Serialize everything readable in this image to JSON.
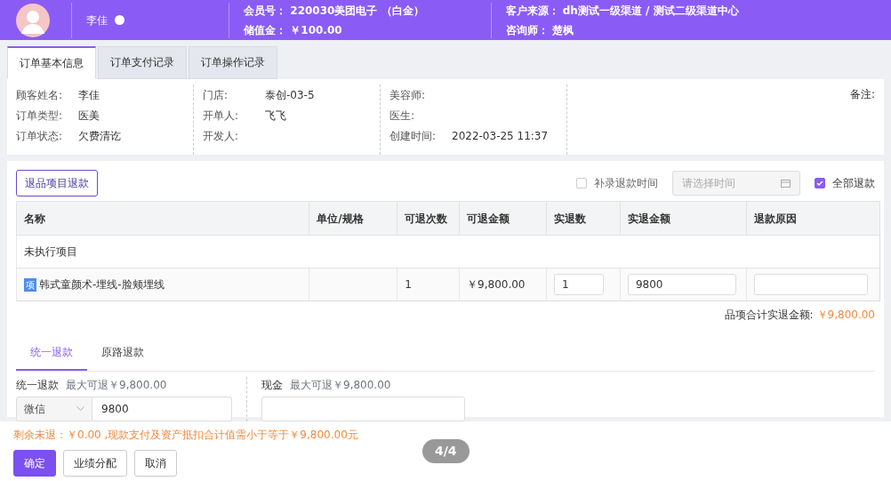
{
  "header": {
    "name": "李佳",
    "fields": [
      {
        "label": "会员号：",
        "value": "220030美团电子 （白金）"
      },
      {
        "label": "储值金：",
        "value": "￥100.00"
      },
      {
        "label": "客户来源：",
        "value": "dh测试一级渠道 / 测试二级渠道中心"
      },
      {
        "label": "咨询师：",
        "value": "楚枫"
      }
    ]
  },
  "tabs": [
    {
      "label": "订单基本信息",
      "selected": true
    },
    {
      "label": "订单支付记录",
      "selected": false
    },
    {
      "label": "订单操作记录",
      "selected": false
    }
  ],
  "info": {
    "columns": [
      [
        {
          "label": "顾客姓名:",
          "value": "李佳"
        },
        {
          "label": "订单类型:",
          "value": "医美"
        },
        {
          "label": "订单状态:",
          "value": "欠费清讫"
        }
      ],
      [
        {
          "label": "门店:",
          "value": "泰创-03-5"
        },
        {
          "label": "开单人:",
          "value": "飞飞"
        },
        {
          "label": "开发人:"
        }
      ],
      [
        {
          "label": "美容师:"
        },
        {
          "label": "医生:"
        },
        {
          "label": "创建时间:",
          "value": "2022-03-25 11:37"
        }
      ]
    ],
    "remark_label": "备注:"
  },
  "refund": {
    "return_button": "退品项目退款",
    "supplement": {
      "label": "补录退款时间",
      "checked": false
    },
    "date_placeholder": "请选择时间",
    "all_refund": {
      "label": "全部退款",
      "checked": true
    },
    "columns": [
      "名称",
      "单位/规格",
      "可退次数",
      "可退金额",
      "实退数",
      "实退金额",
      "退款原因"
    ],
    "group": "未执行项目",
    "rows": [
      {
        "tag": "项",
        "name": "韩式童颜术-埋线-脸颊埋线",
        "times": "1",
        "amount": "￥9,800.00",
        "qty": "1",
        "refund_amount": "9800"
      }
    ],
    "total_label": "品项合计实退金额:",
    "total_value": "￥9,800.00"
  },
  "method_tabs": [
    {
      "label": "统一退款",
      "selected": true
    },
    {
      "label": "原路退款",
      "selected": false
    }
  ],
  "unified": {
    "label": "统一退款",
    "hint": "最大可退￥9,800.00",
    "channel": "微信",
    "amount": "9800"
  },
  "cash": {
    "label": "现金",
    "hint": "最大可退￥9,800.00"
  },
  "footer": {
    "warning": "剩余未退：￥0.00 ,现款支付及资产抵扣合计值需小于等于￥9,800.00元",
    "buttons": [
      {
        "label": "确定",
        "kind": "primary"
      },
      {
        "label": "业绩分配",
        "kind": "default"
      },
      {
        "label": "取消",
        "kind": "default"
      }
    ],
    "page_indicator": "4/4"
  }
}
